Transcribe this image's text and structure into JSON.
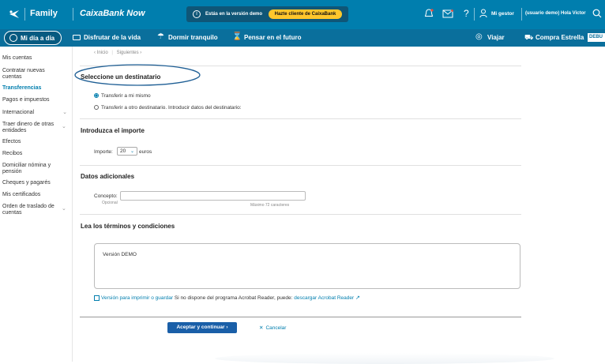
{
  "topbar": {
    "brand_family": "Family",
    "brand_caixa": "CaixaBank Now",
    "demo_text": "Estás en la versión demo",
    "cta": "Hazte cliente de CaixaBank",
    "gestor": "Mi gestor",
    "user": "(usuario demo) Hola Victor"
  },
  "secnav": {
    "items": [
      "Mi día a día",
      "Disfrutar de la vida",
      "Dormir tranquilo",
      "Pensar en el futuro"
    ],
    "right": [
      "Viajar",
      "Compra Estrella"
    ],
    "debug": "DEBU"
  },
  "sidebar": {
    "items": [
      "Mis cuentas",
      "Contratar nuevas cuentas",
      "Transferencias",
      "Pagos e impuestos",
      "Internacional",
      "Traer dinero de otras entidades",
      "Efectos",
      "Recibos",
      "Domiciliar nómina y pensión",
      "Cheques y pagarés",
      "Mis certificados",
      "Orden de traslado de cuentas"
    ]
  },
  "breadcrumb": {
    "prev": "Inicio",
    "next": "Siguientes"
  },
  "form": {
    "title_dest": "Seleccione un destinatario",
    "opt_self": "Transferir a mi mismo",
    "opt_other": "Transferir a otro destinatario. Introducir datos del destinatario:",
    "title_amount": "Introduzca el importe",
    "amount_label": "Importe:",
    "amount_value": "20",
    "amount_unit": "euros",
    "title_extra": "Datos adicionales",
    "concept_label": "Concepto:",
    "concept_sub": "Opcional",
    "concept_max": "Máximo 72 caracteres",
    "title_terms": "Lea los términos y condiciones",
    "terms_text": "Versión DEMO",
    "print_link": "Versión para imprimir o guardar",
    "acrobat_text": "Si no dispone del programa Acrobat Reader, puede:",
    "acrobat_link": "descargar Acrobat Reader",
    "accept": "Aceptar y continuar",
    "cancel": "Cancelar"
  }
}
